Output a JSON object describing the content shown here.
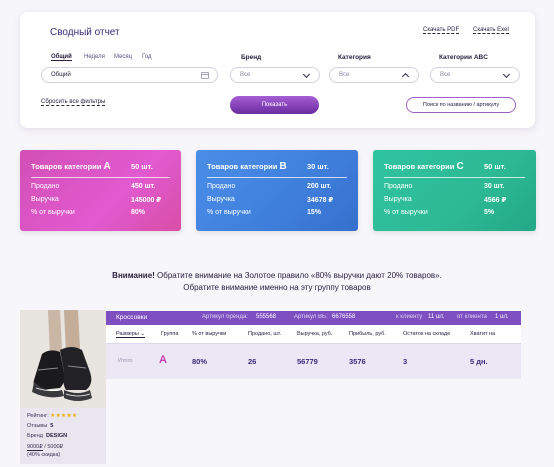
{
  "filters": {
    "title": "Сводный отчет",
    "download_pdf": "Скачать PDF",
    "download_excel": "Скачать Exel",
    "period_tabs": [
      "Общий",
      "Неделя",
      "Месяц",
      "Год"
    ],
    "period_active": "Общий",
    "period_value": "Общий",
    "brand_label": "Бренд",
    "brand_value": "Все",
    "category_label": "Категория",
    "category_value": "Все",
    "abc_label": "Категории ABC",
    "abc_value": "Все",
    "reset_label": "Сбросить все фильтры",
    "show_label": "Показать",
    "search_label": "Поиск по названию / артикулу"
  },
  "categories": [
    {
      "head": "Товаров категории ",
      "letter": "A",
      "count": "50 шт.",
      "sold_label": "Продано",
      "sold": "450 шт.",
      "revenue_label": "Выручка",
      "revenue": "145000 ₽",
      "pct_label": "% от выручки",
      "pct": "80%"
    },
    {
      "head": "Товаров категории ",
      "letter": "B",
      "count": "30 шт.",
      "sold_label": "Продано",
      "sold": "200 шт.",
      "revenue_label": "Выручка",
      "revenue": "34678 ₽",
      "pct_label": "% от выручки",
      "pct": "15%"
    },
    {
      "head": "Товаров категории ",
      "letter": "C",
      "count": "50 шт.",
      "sold_label": "Продано",
      "sold": "30 шт.",
      "revenue_label": "Выручка",
      "revenue": "4566 ₽",
      "pct_label": "% от выручки",
      "pct": "5%"
    }
  ],
  "notice": {
    "bold": "Внимание!",
    "line1": " Обратите внимание на Золотое правило «80% выручки дают 20% товаров».",
    "line2": "Обратите внимание именно на эту группу товаров"
  },
  "product": {
    "name": "Кроссовки",
    "brand_article_label": "Артикул бренда:",
    "brand_article": "555568",
    "wb_article_label": "Артикул ВБ:",
    "wb_article": "6676558",
    "to_client_label": "к клиенту",
    "to_client": "11 шт.",
    "from_client_label": "от клиента",
    "from_client": "1 шт.",
    "rating_label": "Рейтинг:",
    "rating_stars": "★★★★★",
    "reviews_label": "Отзывы",
    "reviews": "5",
    "brand_label": "Бренд",
    "brand": "DESIGN",
    "price_old": "9000₽",
    "price_new": " / 5000₽",
    "discount": "(40% скидка)"
  },
  "table": {
    "columns": [
      "Размеры",
      "Группа",
      "% от выручки",
      "Продано, шт.",
      "Выручка, руб.",
      "Прибыль, руб.",
      "Остаток на складе",
      "Хватит на"
    ],
    "total": {
      "label": "Итого",
      "group": "A",
      "pct": "80%",
      "sold": "26",
      "revenue": "56779",
      "profit": "3576",
      "stock": "3",
      "enough_for": "5 дн."
    }
  },
  "colors": {
    "cat_a": "#d84eb9",
    "cat_b": "#4182e0",
    "cat_c": "#2cbb98",
    "accent": "#7e4fc0",
    "show_button": "#8a3fbf"
  }
}
